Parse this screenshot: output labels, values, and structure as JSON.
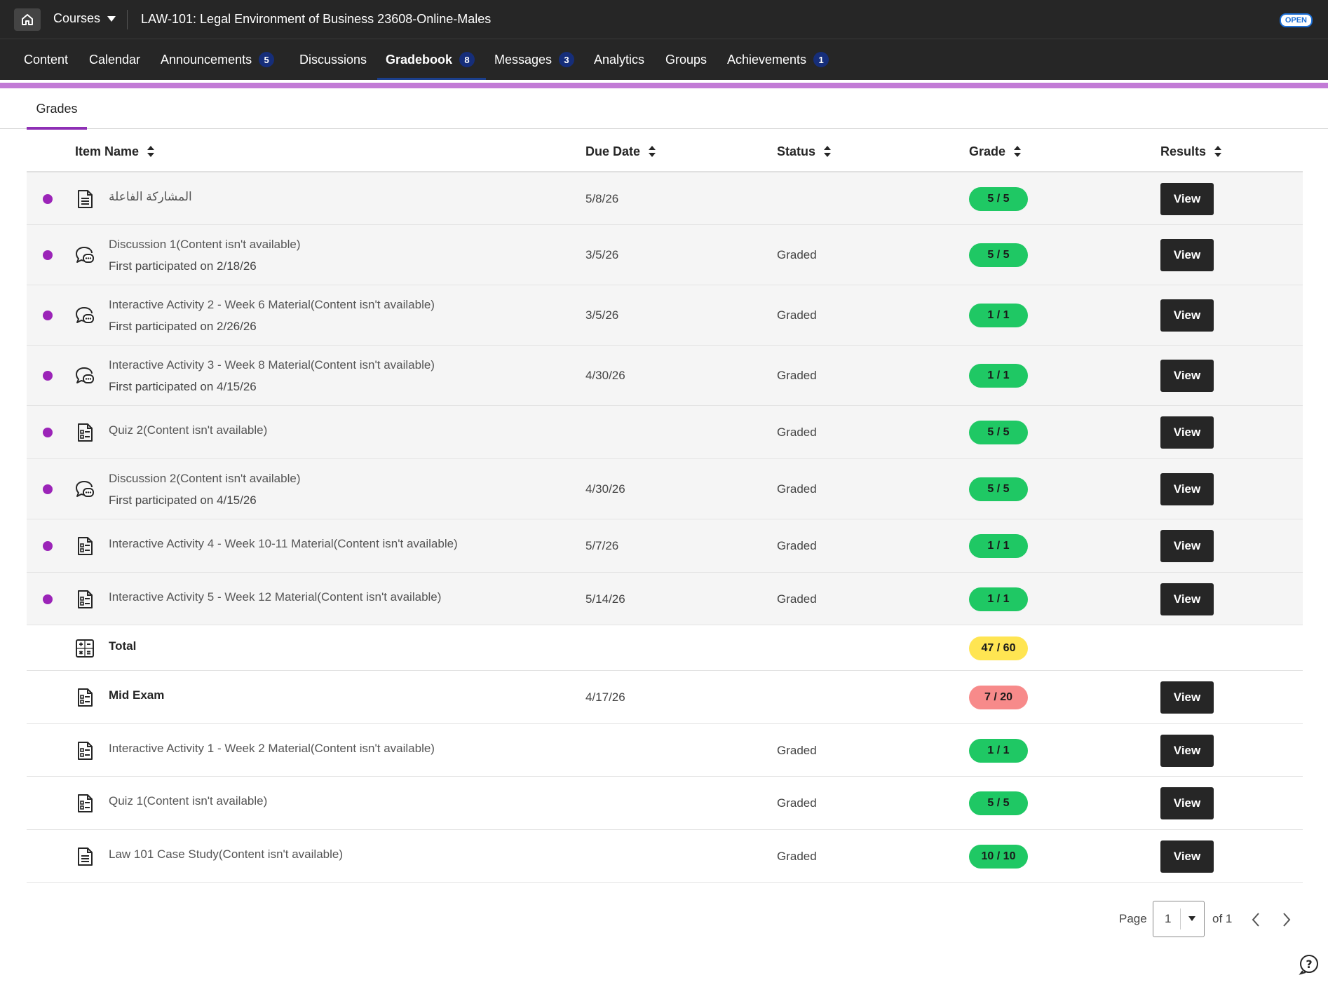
{
  "topbar": {
    "home_icon": "home-icon",
    "courses_label": "Courses",
    "course_title": "LAW-101: Legal Environment of Business 23608-Online-Males",
    "open_badge": "OPEN"
  },
  "nav": {
    "items": [
      {
        "label": "Content",
        "badge": ""
      },
      {
        "label": "Calendar",
        "badge": ""
      },
      {
        "label": "Announcements",
        "badge": "5"
      },
      {
        "label": "Discussions",
        "badge": ""
      },
      {
        "label": "Gradebook",
        "badge": "8",
        "active": true
      },
      {
        "label": "Messages",
        "badge": "3"
      },
      {
        "label": "Analytics",
        "badge": ""
      },
      {
        "label": "Groups",
        "badge": ""
      },
      {
        "label": "Achievements",
        "badge": "1"
      }
    ]
  },
  "subtabs": {
    "grades": "Grades"
  },
  "columns": {
    "item_name": "Item Name",
    "due_date": "Due Date",
    "status": "Status",
    "grade": "Grade",
    "results": "Results"
  },
  "rows": [
    {
      "name": "المشاركة الفاعلة",
      "sub": "",
      "due": "5/8/26",
      "status": "",
      "grade": "5 / 5",
      "grade_color": "#1fc864",
      "view": "View",
      "icon": "document-icon",
      "new": true
    },
    {
      "name": "Discussion 1(Content isn't available)",
      "sub": "First participated on 2/18/26",
      "due": "3/5/26",
      "status": "Graded",
      "grade": "5 / 5",
      "grade_color": "#1fc864",
      "view": "View",
      "icon": "discussion-icon",
      "new": true
    },
    {
      "name": "Interactive Activity 2 - Week 6 Material(Content isn't available)",
      "sub": "First participated on 2/26/26",
      "due": "3/5/26",
      "status": "Graded",
      "grade": "1 / 1",
      "grade_color": "#1fc864",
      "view": "View",
      "icon": "discussion-icon",
      "new": true
    },
    {
      "name": "Interactive Activity 3 - Week 8 Material(Content isn't available)",
      "sub": "First participated on 4/15/26",
      "due": "4/30/26",
      "status": "Graded",
      "grade": "1 / 1",
      "grade_color": "#1fc864",
      "view": "View",
      "icon": "discussion-icon",
      "new": true
    },
    {
      "name": "Quiz 2(Content isn't available)",
      "sub": "",
      "due": "",
      "status": "Graded",
      "grade": "5 / 5",
      "grade_color": "#1fc864",
      "view": "View",
      "icon": "test-icon",
      "new": true
    },
    {
      "name": "Discussion 2(Content isn't available)",
      "sub": "First participated on 4/15/26",
      "due": "4/30/26",
      "status": "Graded",
      "grade": "5 / 5",
      "grade_color": "#1fc864",
      "view": "View",
      "icon": "discussion-icon",
      "new": true
    },
    {
      "name": "Interactive Activity 4 - Week 10-11 Material(Content isn't available)",
      "sub": "",
      "due": "5/7/26",
      "status": "Graded",
      "grade": "1 / 1",
      "grade_color": "#1fc864",
      "view": "View",
      "icon": "test-icon",
      "new": true
    },
    {
      "name": "Interactive Activity 5 - Week 12 Material(Content isn't available)",
      "sub": "",
      "due": "5/14/26",
      "status": "Graded",
      "grade": "1 / 1",
      "grade_color": "#1fc864",
      "view": "View",
      "icon": "test-icon",
      "new": true
    },
    {
      "name": "Total",
      "sub": "",
      "due": "",
      "status": "",
      "grade": "47 / 60",
      "grade_color": "#ffe552",
      "view": "",
      "icon": "calculator-icon",
      "new": false,
      "bold": true
    },
    {
      "name": "Mid Exam",
      "sub": "",
      "due": "4/17/26",
      "status": "",
      "grade": "7 / 20",
      "grade_color": "#f78a8a",
      "view": "View",
      "icon": "test-icon",
      "new": false,
      "bold": true
    },
    {
      "name": "Interactive Activity 1 - Week 2 Material(Content isn't available)",
      "sub": "",
      "due": "",
      "status": "Graded",
      "grade": "1 / 1",
      "grade_color": "#1fc864",
      "view": "View",
      "icon": "test-icon",
      "new": false
    },
    {
      "name": "Quiz 1(Content isn't available)",
      "sub": "",
      "due": "",
      "status": "Graded",
      "grade": "5 / 5",
      "grade_color": "#1fc864",
      "view": "View",
      "icon": "test-icon",
      "new": false
    },
    {
      "name": "Law 101 Case Study(Content isn't available)",
      "sub": "",
      "due": "",
      "status": "Graded",
      "grade": "10 / 10",
      "grade_color": "#1fc864",
      "view": "View",
      "icon": "document-icon",
      "new": false
    }
  ],
  "pagination": {
    "page_label": "Page",
    "current_page": "1",
    "of_label": "of 1"
  }
}
